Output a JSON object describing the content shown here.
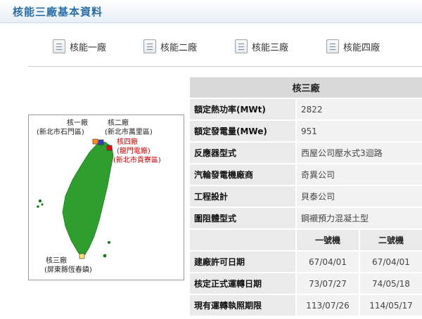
{
  "page": {
    "title": "核能三廠基本資料"
  },
  "nav": [
    {
      "label": "核能一廠",
      "icon": "document-icon"
    },
    {
      "label": "核能二廠",
      "icon": "document-icon"
    },
    {
      "label": "核能三廠",
      "icon": "document-icon"
    },
    {
      "label": "核能四廠",
      "icon": "document-icon"
    }
  ],
  "map": {
    "labels": {
      "plant1": "核一廠",
      "plant1_loc": "(新北市石門區)",
      "plant2": "核二廠",
      "plant2_loc": "(新北市萬里區)",
      "plant4": "核四廠",
      "plant4_alt": "(龍門電廠)",
      "plant4_loc": "(新北市貢寮區)",
      "plant3": "核三廠",
      "plant3_loc": "(屏東縣恆春鎮)"
    },
    "colors": {
      "land": "#2e9e2e",
      "plant1": "#ff8a1a",
      "plant2": "#3a3ac8",
      "plant4": "#e01010",
      "plant3": "#ffe070"
    }
  },
  "table": {
    "header": "核三廠",
    "rows": [
      {
        "key": "額定熱功率(MWt)",
        "value": "2822"
      },
      {
        "key": "額定發電量(MWe)",
        "value": "951"
      },
      {
        "key": "反應器型式",
        "value": "西屋公司壓水式3迴路"
      },
      {
        "key": "汽輪發電機廠商",
        "value": "奇異公司"
      },
      {
        "key": "工程設計",
        "value": "貝泰公司"
      },
      {
        "key": "圍阻體型式",
        "value": "鋼襯預力混凝土型"
      }
    ],
    "units": [
      "一號機",
      "二號機"
    ],
    "unit_rows": [
      {
        "key": "建廠許可日期",
        "u1": "67/04/01",
        "u2": "67/04/01"
      },
      {
        "key": "核定正式運轉日期",
        "u1": "73/07/27",
        "u2": "74/05/18"
      },
      {
        "key": "現有運轉執照期限",
        "u1": "113/07/26",
        "u2": "114/05/17"
      }
    ]
  }
}
